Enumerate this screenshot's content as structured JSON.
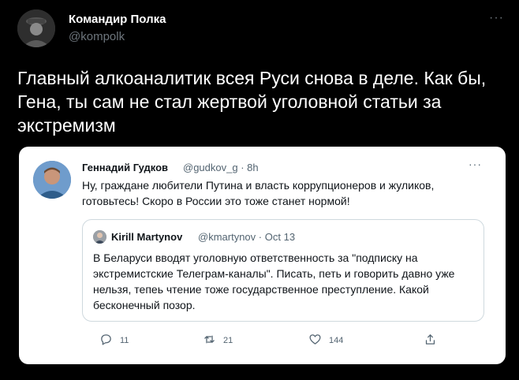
{
  "tweet": {
    "author_name": "Командир Полка",
    "author_handle": "@kompolk",
    "more": "···",
    "text": "Главный алкоаналитик всея Руси снова в деле. Как бы, Гена, ты сам не стал жертвой уголовной статьи за экстремизм"
  },
  "embedded": {
    "author_name": "Геннадий Гудков",
    "author_handle": "@gudkov_g",
    "time": "8h",
    "more": "···",
    "text": "Ну, граждане любители Путина и власть коррупционеров и жуликов, готовьтесь! Скоро в России это тоже станет нормой!",
    "quote": {
      "author_name": "Kirill Martynov",
      "author_handle": "@kmartynov",
      "date": "Oct 13",
      "text": "В Беларуси  вводят уголовную ответственность за \"подписку на экстремистские Телеграм-каналы\". Писать, петь и говорить давно уже нельзя, тепеь чтение тоже государственное преступление. Какой бесконечный позор."
    },
    "actions": {
      "replies": "11",
      "retweets": "21",
      "likes": "144"
    }
  },
  "icons": {
    "reply": "reply-icon",
    "retweet": "retweet-icon",
    "like": "heart-icon",
    "share": "share-icon"
  }
}
